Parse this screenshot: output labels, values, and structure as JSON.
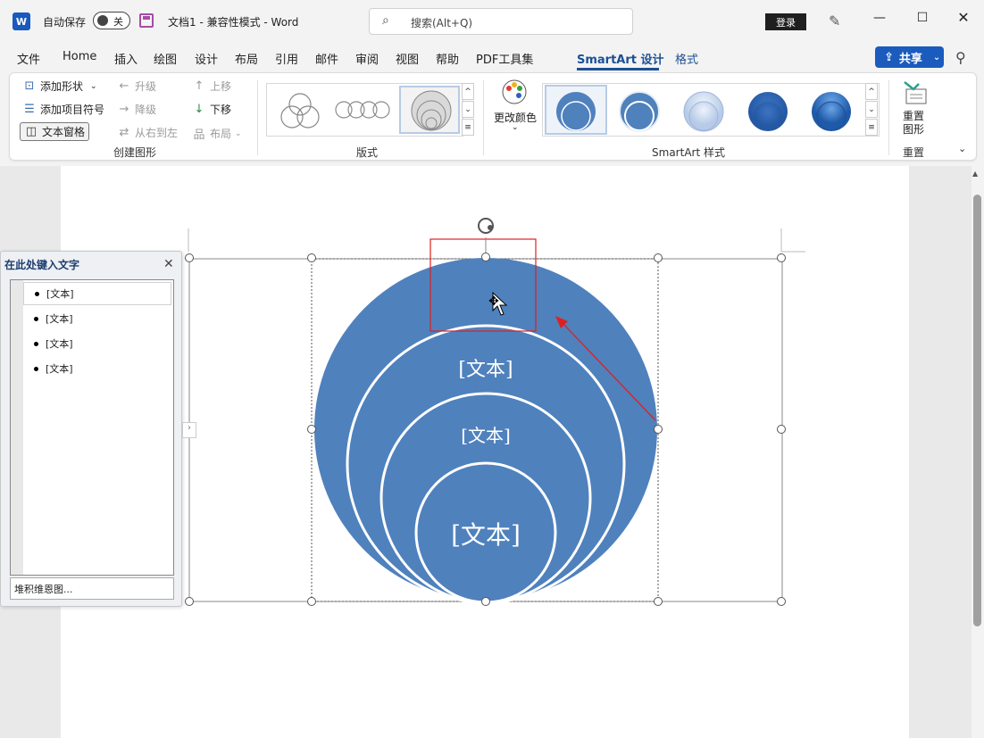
{
  "title_bar": {
    "app_logo": "W",
    "autosave_label": "自动保存",
    "autosave_state": "关",
    "document_title": "文档1  -  兼容性模式  -  Word",
    "search_placeholder": "搜索(Alt+Q)",
    "login_label": "登录",
    "icons": [
      "word-logo-icon",
      "save-icon",
      "search-icon",
      "brush-icon",
      "minimize-icon",
      "maximize-icon",
      "close-icon"
    ]
  },
  "menu_tabs": [
    "文件",
    "Home",
    "插入",
    "绘图",
    "设计",
    "布局",
    "引用",
    "邮件",
    "审阅",
    "视图",
    "帮助",
    "PDF工具集",
    "SmartArt 设计",
    "格式"
  ],
  "share_label": "共享",
  "ribbon": {
    "create_graphic": {
      "add_shape": "添加形状",
      "add_bullet": "添加项目符号",
      "text_pane": "文本窗格",
      "promote": "升级",
      "demote": "降级",
      "right_to_left": "从右到左",
      "move_up": "上移",
      "move_down": "下移",
      "layout": "布局",
      "label": "创建图形"
    },
    "layouts_label": "版式",
    "change_colors": "更改颜色",
    "smartart_styles_label": "SmartArt 样式",
    "reset_graphic": "重置图形",
    "reset_label": "重置"
  },
  "text_pane": {
    "title": "在此处键入文字",
    "items": [
      "[文本]",
      "[文本]",
      "[文本]",
      "[文本]"
    ],
    "footer": "堆积维恩图..."
  },
  "smartart": {
    "fill_color": "#4f81bd",
    "labels": [
      "[文本]",
      "[文本]",
      "[文本]"
    ]
  }
}
